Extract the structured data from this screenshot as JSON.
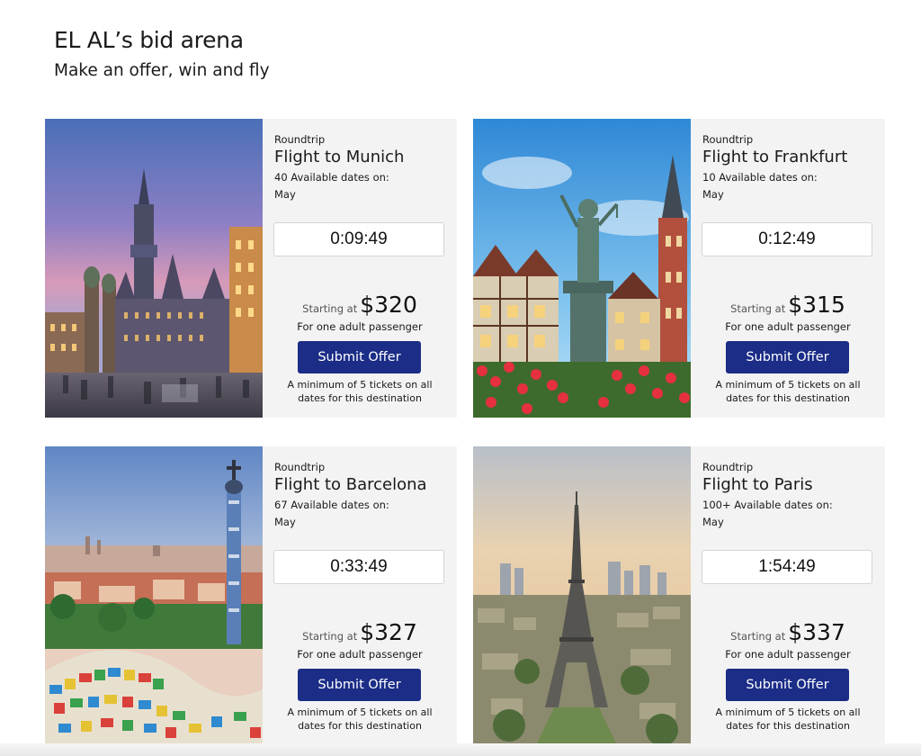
{
  "header": {
    "title": "EL AL’s bid arena",
    "subtitle": "Make an offer, win and fly"
  },
  "cards": [
    {
      "trip_type": "Roundtrip",
      "destination": "Flight to Munich",
      "dates_count": "40 Available dates on:",
      "dates_month": "May",
      "timer": "0:09:49",
      "starting_label": "Starting at",
      "price": "$320",
      "passenger_label": "For one adult passenger",
      "button_label": "Submit Offer",
      "minimum_note": "A minimum of 5 tickets on all dates for this destination"
    },
    {
      "trip_type": "Roundtrip",
      "destination": "Flight to Frankfurt",
      "dates_count": "10 Available dates on:",
      "dates_month": "May",
      "timer": "0:12:49",
      "starting_label": "Starting at",
      "price": "$315",
      "passenger_label": "For one adult passenger",
      "button_label": "Submit Offer",
      "minimum_note": "A minimum of 5 tickets on all dates for this destination"
    },
    {
      "trip_type": "Roundtrip",
      "destination": "Flight to Barcelona",
      "dates_count": "67 Available dates on:",
      "dates_month": "May",
      "timer": "0:33:49",
      "starting_label": "Starting at",
      "price": "$327",
      "passenger_label": "For one adult passenger",
      "button_label": "Submit Offer",
      "minimum_note": "A minimum of 5 tickets on all dates for this destination"
    },
    {
      "trip_type": "Roundtrip",
      "destination": "Flight to Paris",
      "dates_count": "100+ Available dates on:",
      "dates_month": "May",
      "timer": "1:54:49",
      "starting_label": "Starting at",
      "price": "$337",
      "passenger_label": "For one adult passenger",
      "button_label": "Submit Offer",
      "minimum_note": "A minimum of 5 tickets on all dates for this destination"
    }
  ],
  "colors": {
    "button": "#1b2d87",
    "card_background": "#f3f3f3",
    "timer_border": "#d4d4d4"
  }
}
